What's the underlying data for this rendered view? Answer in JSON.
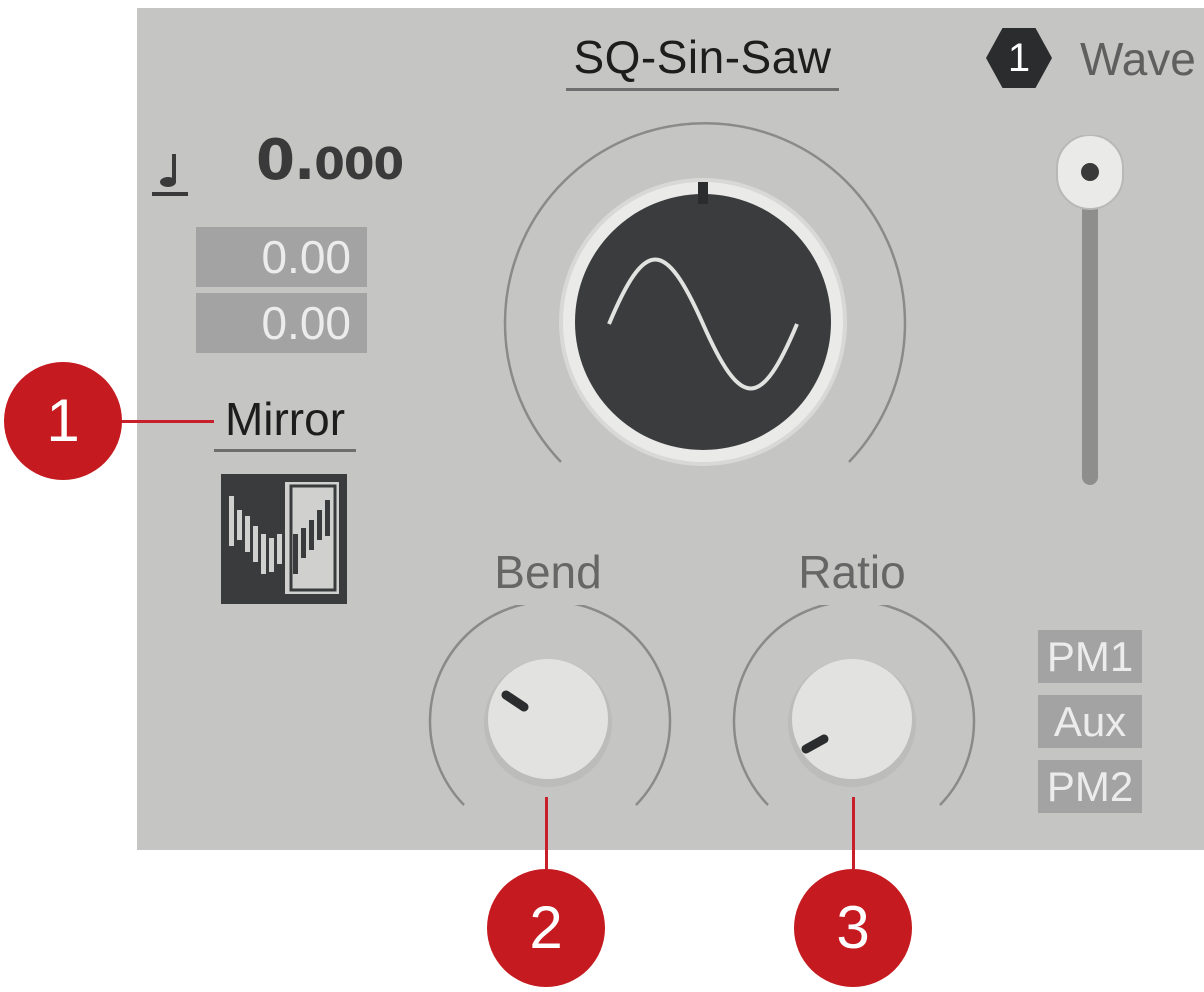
{
  "oscillator": {
    "mode": "SQ-Sin-Saw",
    "index": "1",
    "section_label": "Wave"
  },
  "values": {
    "main_int": "0.",
    "main_dec": "000",
    "box1": "0.00",
    "box2": "0.00"
  },
  "mirror": {
    "label": "Mirror"
  },
  "knobs": {
    "bend_label": "Bend",
    "ratio_label": "Ratio"
  },
  "mod_tags": [
    "PM1",
    "Aux",
    "PM2"
  ],
  "callouts": [
    "1",
    "2",
    "3"
  ],
  "colors": {
    "panel": "#c5c5c3",
    "callout": "#c51a1f",
    "dark": "#2b2c2e"
  },
  "icons": {
    "note": "eighth-note-icon",
    "mirror": "mirror-waveform-icon",
    "wave": "sine-wave-icon"
  }
}
